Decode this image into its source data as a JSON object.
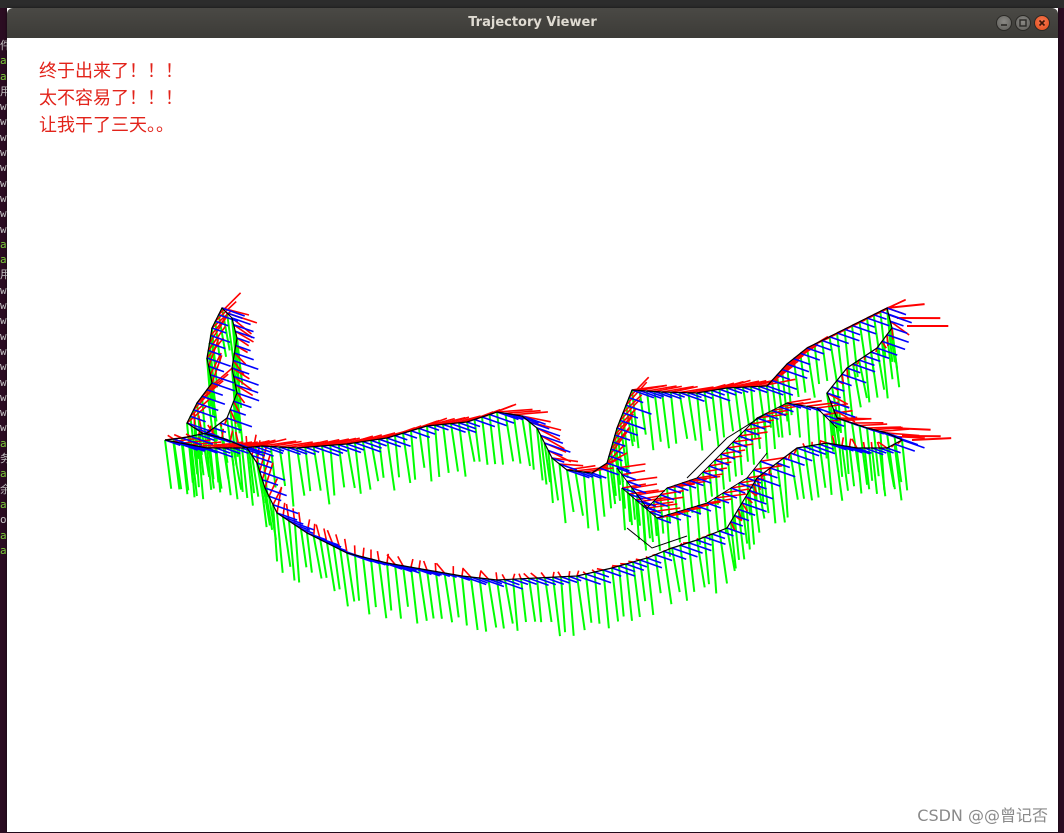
{
  "window": {
    "title": "Trajectory Viewer"
  },
  "overlay": {
    "lines": [
      "终于出来了！！！",
      "太不容易了！！！",
      "让我干了三天。。"
    ],
    "color": "#e2231a"
  },
  "background_terminal": {
    "chars": [
      "件",
      "a",
      "a",
      "用",
      "w",
      "w",
      "w",
      "w",
      "w",
      "w",
      "w",
      "w",
      "w",
      "a",
      "a",
      "用",
      "w",
      "w",
      "w",
      "w",
      "w",
      "w",
      "w",
      "w",
      "w",
      "w",
      "a",
      "务",
      "a",
      "余",
      "a",
      "o",
      "a",
      "a"
    ]
  },
  "watermark": {
    "text": "CSDN @@曾记否"
  },
  "viewer": {
    "axis_colors": {
      "x": "#ff0000",
      "y": "#00ff00",
      "z": "#0000ff",
      "path": "#000000"
    }
  }
}
